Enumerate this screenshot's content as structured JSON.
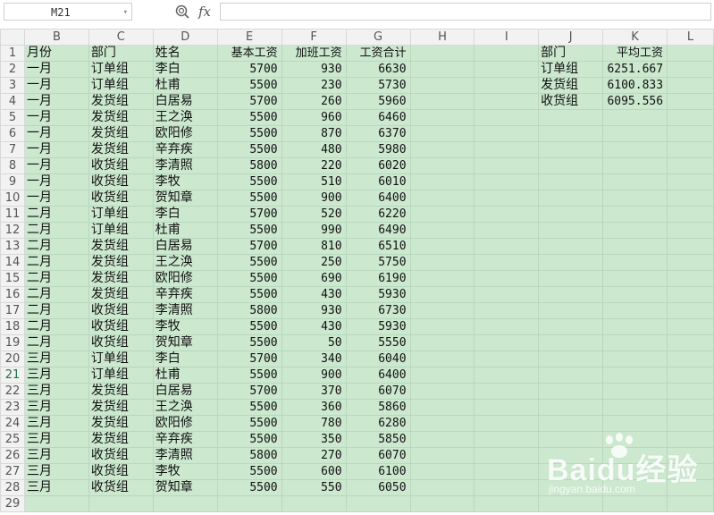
{
  "formula_bar": {
    "name_box_value": "M21",
    "fx_label": "fx",
    "formula_value": ""
  },
  "columns": [
    "",
    "B",
    "C",
    "D",
    "E",
    "F",
    "G",
    "H",
    "I",
    "J",
    "K",
    "L"
  ],
  "active_row": 21,
  "rows": [
    {
      "n": "1",
      "cells": [
        "月份",
        "部门",
        "姓名",
        "基本工资",
        "加班工资",
        "工资合计",
        "",
        "",
        "部门",
        "平均工资",
        ""
      ]
    },
    {
      "n": "2",
      "cells": [
        "一月",
        "订单组",
        "李白",
        "5700",
        "930",
        "6630",
        "",
        "",
        "订单组",
        "6251.667",
        ""
      ]
    },
    {
      "n": "3",
      "cells": [
        "一月",
        "订单组",
        "杜甫",
        "5500",
        "230",
        "5730",
        "",
        "",
        "发货组",
        "6100.833",
        ""
      ]
    },
    {
      "n": "4",
      "cells": [
        "一月",
        "发货组",
        "白居易",
        "5700",
        "260",
        "5960",
        "",
        "",
        "收货组",
        "6095.556",
        ""
      ]
    },
    {
      "n": "5",
      "cells": [
        "一月",
        "发货组",
        "王之涣",
        "5500",
        "960",
        "6460",
        "",
        "",
        "",
        "",
        ""
      ]
    },
    {
      "n": "6",
      "cells": [
        "一月",
        "发货组",
        "欧阳修",
        "5500",
        "870",
        "6370",
        "",
        "",
        "",
        "",
        ""
      ]
    },
    {
      "n": "7",
      "cells": [
        "一月",
        "发货组",
        "辛弃疾",
        "5500",
        "480",
        "5980",
        "",
        "",
        "",
        "",
        ""
      ]
    },
    {
      "n": "8",
      "cells": [
        "一月",
        "收货组",
        "李清照",
        "5800",
        "220",
        "6020",
        "",
        "",
        "",
        "",
        ""
      ]
    },
    {
      "n": "9",
      "cells": [
        "一月",
        "收货组",
        "李牧",
        "5500",
        "510",
        "6010",
        "",
        "",
        "",
        "",
        ""
      ]
    },
    {
      "n": "10",
      "cells": [
        "一月",
        "收货组",
        "贺知章",
        "5500",
        "900",
        "6400",
        "",
        "",
        "",
        "",
        ""
      ]
    },
    {
      "n": "11",
      "cells": [
        "二月",
        "订单组",
        "李白",
        "5700",
        "520",
        "6220",
        "",
        "",
        "",
        "",
        ""
      ]
    },
    {
      "n": "12",
      "cells": [
        "二月",
        "订单组",
        "杜甫",
        "5500",
        "990",
        "6490",
        "",
        "",
        "",
        "",
        ""
      ]
    },
    {
      "n": "13",
      "cells": [
        "二月",
        "发货组",
        "白居易",
        "5700",
        "810",
        "6510",
        "",
        "",
        "",
        "",
        ""
      ]
    },
    {
      "n": "14",
      "cells": [
        "二月",
        "发货组",
        "王之涣",
        "5500",
        "250",
        "5750",
        "",
        "",
        "",
        "",
        ""
      ]
    },
    {
      "n": "15",
      "cells": [
        "二月",
        "发货组",
        "欧阳修",
        "5500",
        "690",
        "6190",
        "",
        "",
        "",
        "",
        ""
      ]
    },
    {
      "n": "16",
      "cells": [
        "二月",
        "发货组",
        "辛弃疾",
        "5500",
        "430",
        "5930",
        "",
        "",
        "",
        "",
        ""
      ]
    },
    {
      "n": "17",
      "cells": [
        "二月",
        "收货组",
        "李清照",
        "5800",
        "930",
        "6730",
        "",
        "",
        "",
        "",
        ""
      ]
    },
    {
      "n": "18",
      "cells": [
        "二月",
        "收货组",
        "李牧",
        "5500",
        "430",
        "5930",
        "",
        "",
        "",
        "",
        ""
      ]
    },
    {
      "n": "19",
      "cells": [
        "二月",
        "收货组",
        "贺知章",
        "5500",
        "50",
        "5550",
        "",
        "",
        "",
        "",
        ""
      ]
    },
    {
      "n": "20",
      "cells": [
        "三月",
        "订单组",
        "李白",
        "5700",
        "340",
        "6040",
        "",
        "",
        "",
        "",
        ""
      ]
    },
    {
      "n": "21",
      "cells": [
        "三月",
        "订单组",
        "杜甫",
        "5500",
        "900",
        "6400",
        "",
        "",
        "",
        "",
        ""
      ]
    },
    {
      "n": "22",
      "cells": [
        "三月",
        "发货组",
        "白居易",
        "5700",
        "370",
        "6070",
        "",
        "",
        "",
        "",
        ""
      ]
    },
    {
      "n": "23",
      "cells": [
        "三月",
        "发货组",
        "王之涣",
        "5500",
        "360",
        "5860",
        "",
        "",
        "",
        "",
        ""
      ]
    },
    {
      "n": "24",
      "cells": [
        "三月",
        "发货组",
        "欧阳修",
        "5500",
        "780",
        "6280",
        "",
        "",
        "",
        "",
        ""
      ]
    },
    {
      "n": "25",
      "cells": [
        "三月",
        "发货组",
        "辛弃疾",
        "5500",
        "350",
        "5850",
        "",
        "",
        "",
        "",
        ""
      ]
    },
    {
      "n": "26",
      "cells": [
        "三月",
        "收货组",
        "李清照",
        "5800",
        "270",
        "6070",
        "",
        "",
        "",
        "",
        ""
      ]
    },
    {
      "n": "27",
      "cells": [
        "三月",
        "收货组",
        "李牧",
        "5500",
        "600",
        "6100",
        "",
        "",
        "",
        "",
        ""
      ]
    },
    {
      "n": "28",
      "cells": [
        "三月",
        "收货组",
        "贺知章",
        "5500",
        "550",
        "6050",
        "",
        "",
        "",
        "",
        ""
      ]
    },
    {
      "n": "29",
      "cells": [
        "",
        "",
        "",
        "",
        "",
        "",
        "",
        "",
        "",
        "",
        ""
      ]
    }
  ],
  "watermark": {
    "logo_text": "Baidu经验",
    "url_text": "jingyan.baidu.com"
  }
}
